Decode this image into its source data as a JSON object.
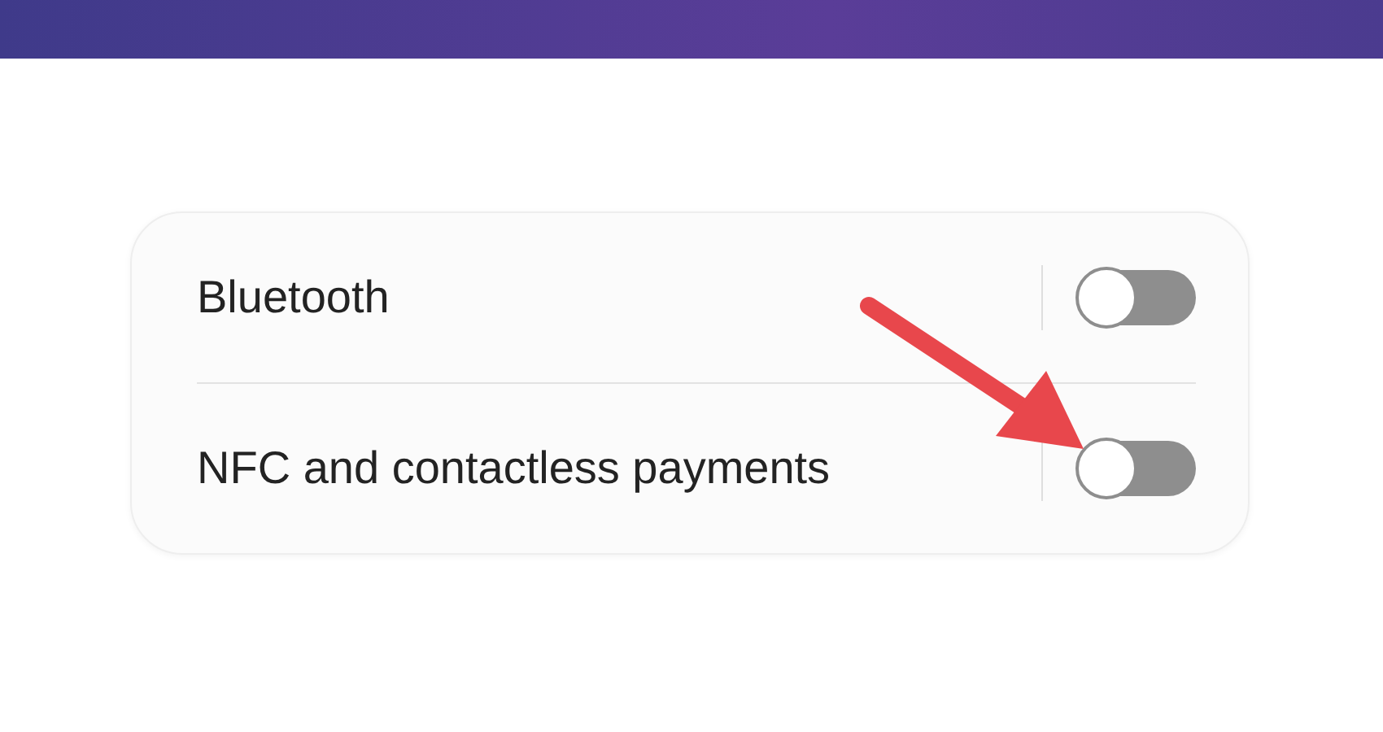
{
  "settings": [
    {
      "label": "Bluetooth",
      "on": false
    },
    {
      "label": "NFC and contactless payments",
      "on": false
    }
  ]
}
